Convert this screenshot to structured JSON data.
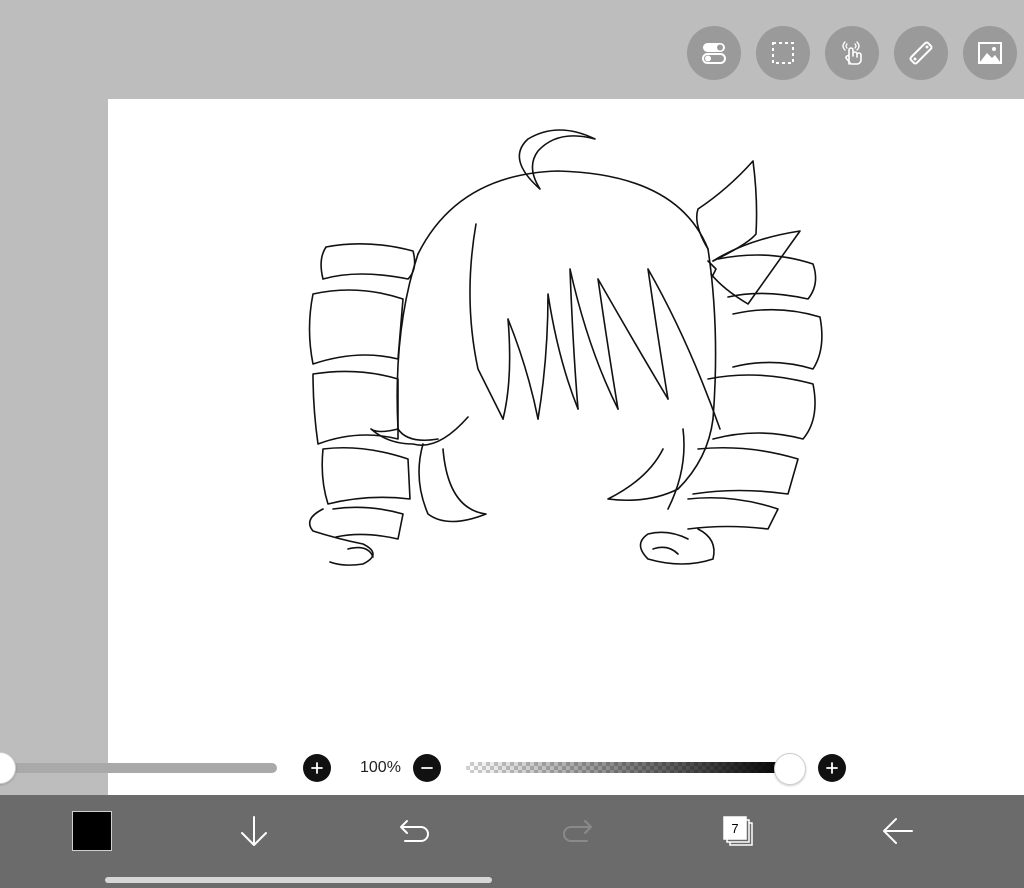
{
  "toolbar": {
    "tools": [
      {
        "name": "toggle-icon"
      },
      {
        "name": "selection-icon"
      },
      {
        "name": "hand-touch-icon"
      },
      {
        "name": "ruler-icon"
      },
      {
        "name": "image-icon"
      }
    ]
  },
  "brush": {
    "size_fraction": 0.0
  },
  "zoom": {
    "label": "100%"
  },
  "opacity": {
    "fraction": 1.0
  },
  "bottom_bar": {
    "color": "#000000",
    "layers_count": "7",
    "icons": [
      "download-arrow-icon",
      "undo-icon",
      "redo-icon",
      "layers-icon",
      "back-arrow-icon"
    ]
  },
  "colors": {
    "background": "#bdbdbd",
    "canvas": "#ffffff",
    "toolbar_button": "#9a9a9a",
    "bottom_bar": "#6b6b6b"
  }
}
